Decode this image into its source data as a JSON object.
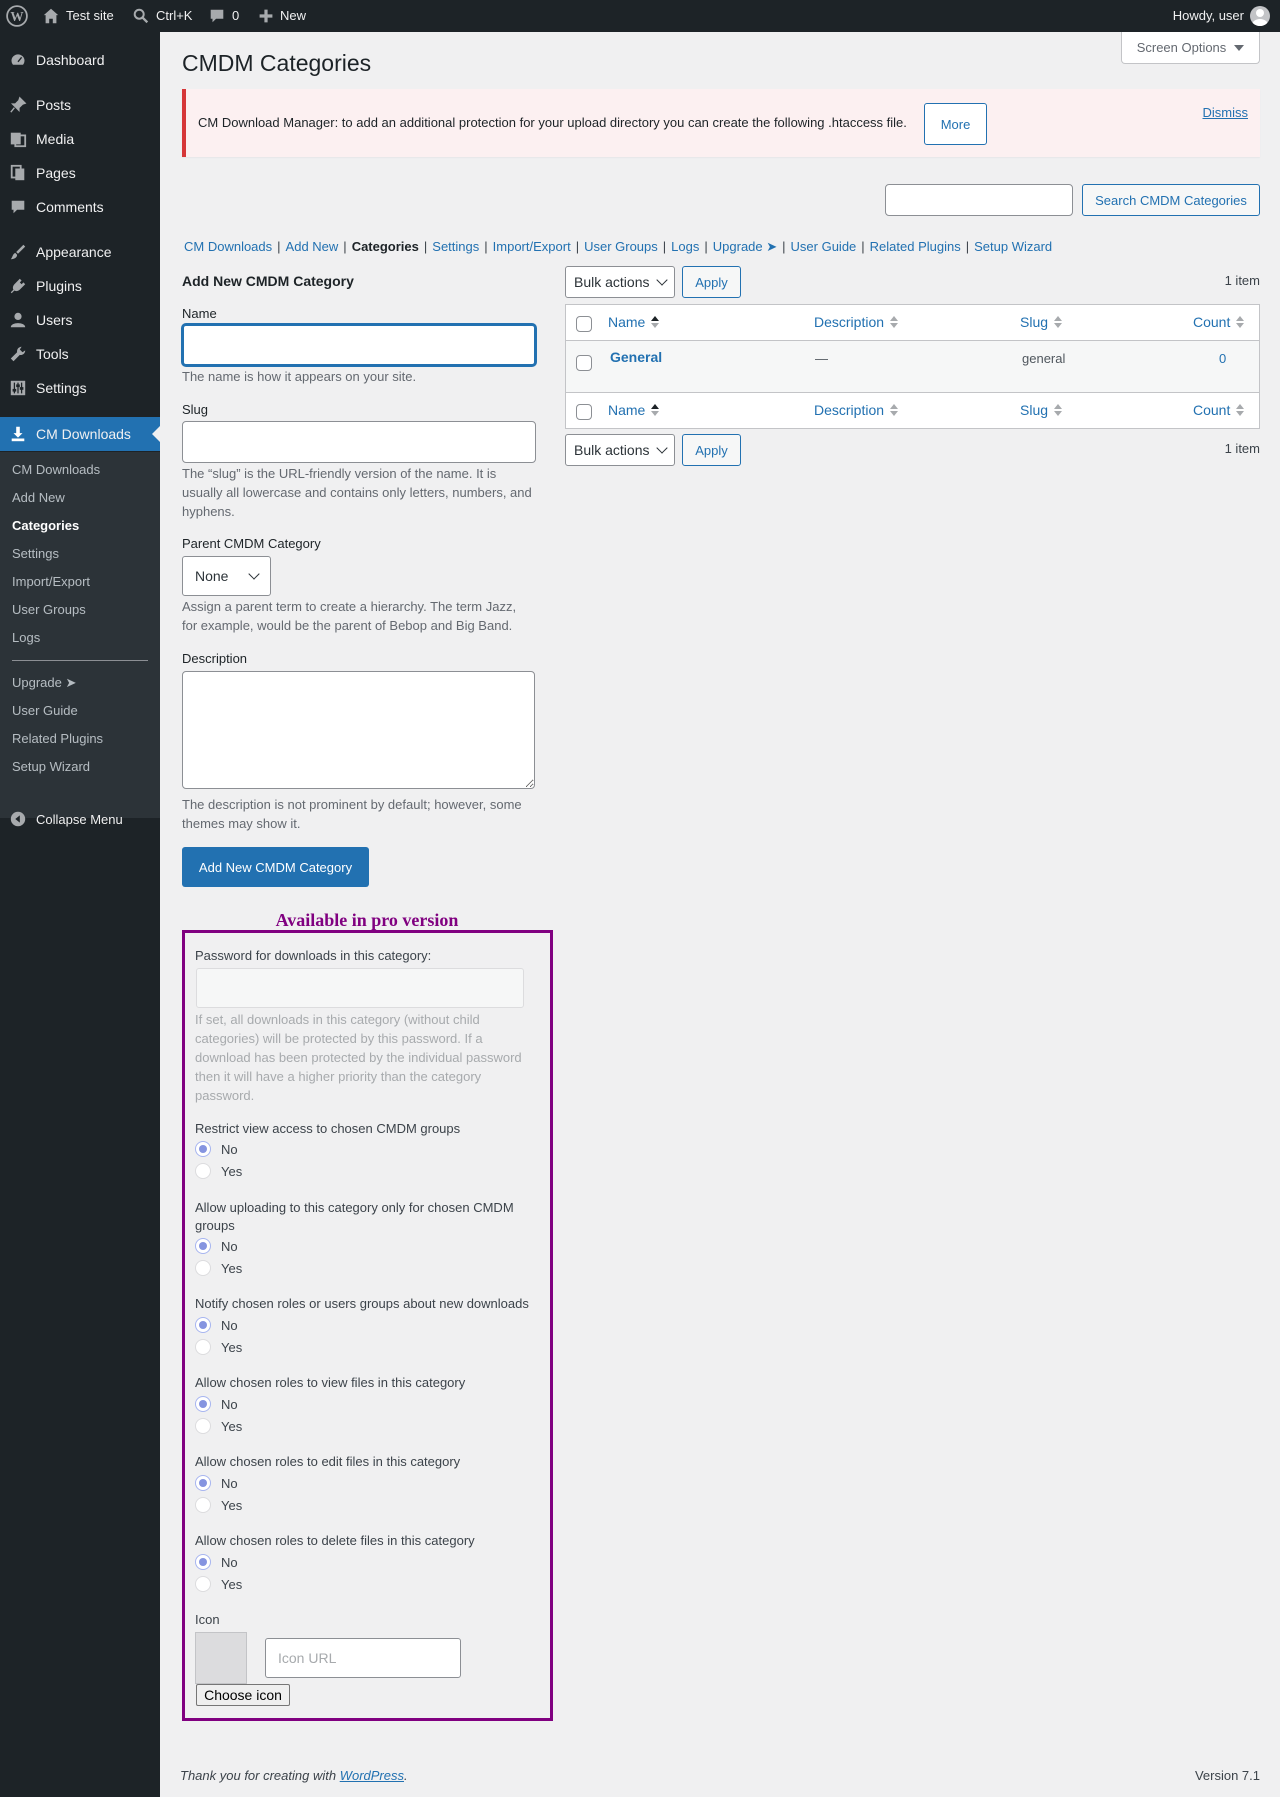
{
  "admin_bar": {
    "site_name": "Test site",
    "search_shortcut": "Ctrl+K",
    "comments_count": "0",
    "new_label": "New",
    "greeting": "Howdy, user"
  },
  "sidebar": {
    "items": [
      {
        "label": "Dashboard",
        "icon": "dashboard-icon"
      },
      {
        "label": "Posts",
        "icon": "pin-icon"
      },
      {
        "label": "Media",
        "icon": "media-icon"
      },
      {
        "label": "Pages",
        "icon": "pages-icon"
      },
      {
        "label": "Comments",
        "icon": "comment-icon"
      },
      {
        "label": "Appearance",
        "icon": "brush-icon"
      },
      {
        "label": "Plugins",
        "icon": "plug-icon"
      },
      {
        "label": "Users",
        "icon": "user-icon"
      },
      {
        "label": "Tools",
        "icon": "wrench-icon"
      },
      {
        "label": "Settings",
        "icon": "sliders-icon"
      },
      {
        "label": "CM Downloads",
        "icon": "download-icon"
      }
    ],
    "submenu": [
      "CM Downloads",
      "Add New",
      "Categories",
      "Settings",
      "Import/Export",
      "User Groups",
      "Logs",
      "Upgrade ➤",
      "User Guide",
      "Related Plugins",
      "Setup Wizard"
    ],
    "collapse_label": "Collapse Menu"
  },
  "page": {
    "title": "CMDM Categories",
    "screen_options": "Screen Options"
  },
  "notice": {
    "message": "CM Download Manager: to add an additional protection for your upload directory you can create the following .htaccess file.",
    "more_label": "More",
    "dismiss_label": "Dismiss"
  },
  "search": {
    "value": "",
    "button_label": "Search CMDM Categories"
  },
  "plugin_nav": [
    "CM Downloads",
    "Add New",
    "Categories",
    "Settings",
    "Import/Export",
    "User Groups",
    "Logs",
    "Upgrade ➤",
    "User Guide",
    "Related Plugins",
    "Setup Wizard"
  ],
  "form": {
    "heading": "Add New CMDM Category",
    "name_label": "Name",
    "name_help": "The name is how it appears on your site.",
    "slug_label": "Slug",
    "slug_help": "The “slug” is the URL-friendly version of the name. It is usually all lowercase and contains only letters, numbers, and hyphens.",
    "parent_label": "Parent CMDM Category",
    "parent_value": "None",
    "parent_help": "Assign a parent term to create a hierarchy. The term Jazz, for example, would be the parent of Bebop and Big Band.",
    "description_label": "Description",
    "description_help": "The description is not prominent by default; however, some themes may show it.",
    "submit_label": "Add New CMDM Category"
  },
  "pro": {
    "title": "Available in pro version",
    "password_label": "Password for downloads in this category:",
    "password_help": "If set, all downloads in this category (without child categories) will be protected by this password. If a download has been protected by the individual password then it will have a higher priority than the category password.",
    "options": [
      {
        "label": "Restrict view access to chosen CMDM groups",
        "no": "No",
        "yes": "Yes"
      },
      {
        "label": "Allow uploading to this category only for chosen CMDM groups",
        "no": "No",
        "yes": "Yes"
      },
      {
        "label": "Notify chosen roles or users groups about new downloads",
        "no": "No",
        "yes": "Yes"
      },
      {
        "label": "Allow chosen roles to view files in this category",
        "no": "No",
        "yes": "Yes"
      },
      {
        "label": "Allow chosen roles to edit files in this category",
        "no": "No",
        "yes": "Yes"
      },
      {
        "label": "Allow chosen roles to delete files in this category",
        "no": "No",
        "yes": "Yes"
      }
    ],
    "icon_label": "Icon",
    "icon_url_placeholder": "Icon URL",
    "choose_icon_label": "Choose icon"
  },
  "table": {
    "bulk_actions": "Bulk actions",
    "apply_label": "Apply",
    "items_count": "1 item",
    "columns": [
      "Name",
      "Description",
      "Slug",
      "Count"
    ],
    "rows": [
      {
        "name": "General",
        "description": "—",
        "slug": "general",
        "count": "0"
      }
    ]
  },
  "footer": {
    "thanks_prefix": "Thank you for creating with",
    "wordpress_link": "WordPress",
    "thanks_suffix": ".",
    "version": "Version 7.1"
  }
}
